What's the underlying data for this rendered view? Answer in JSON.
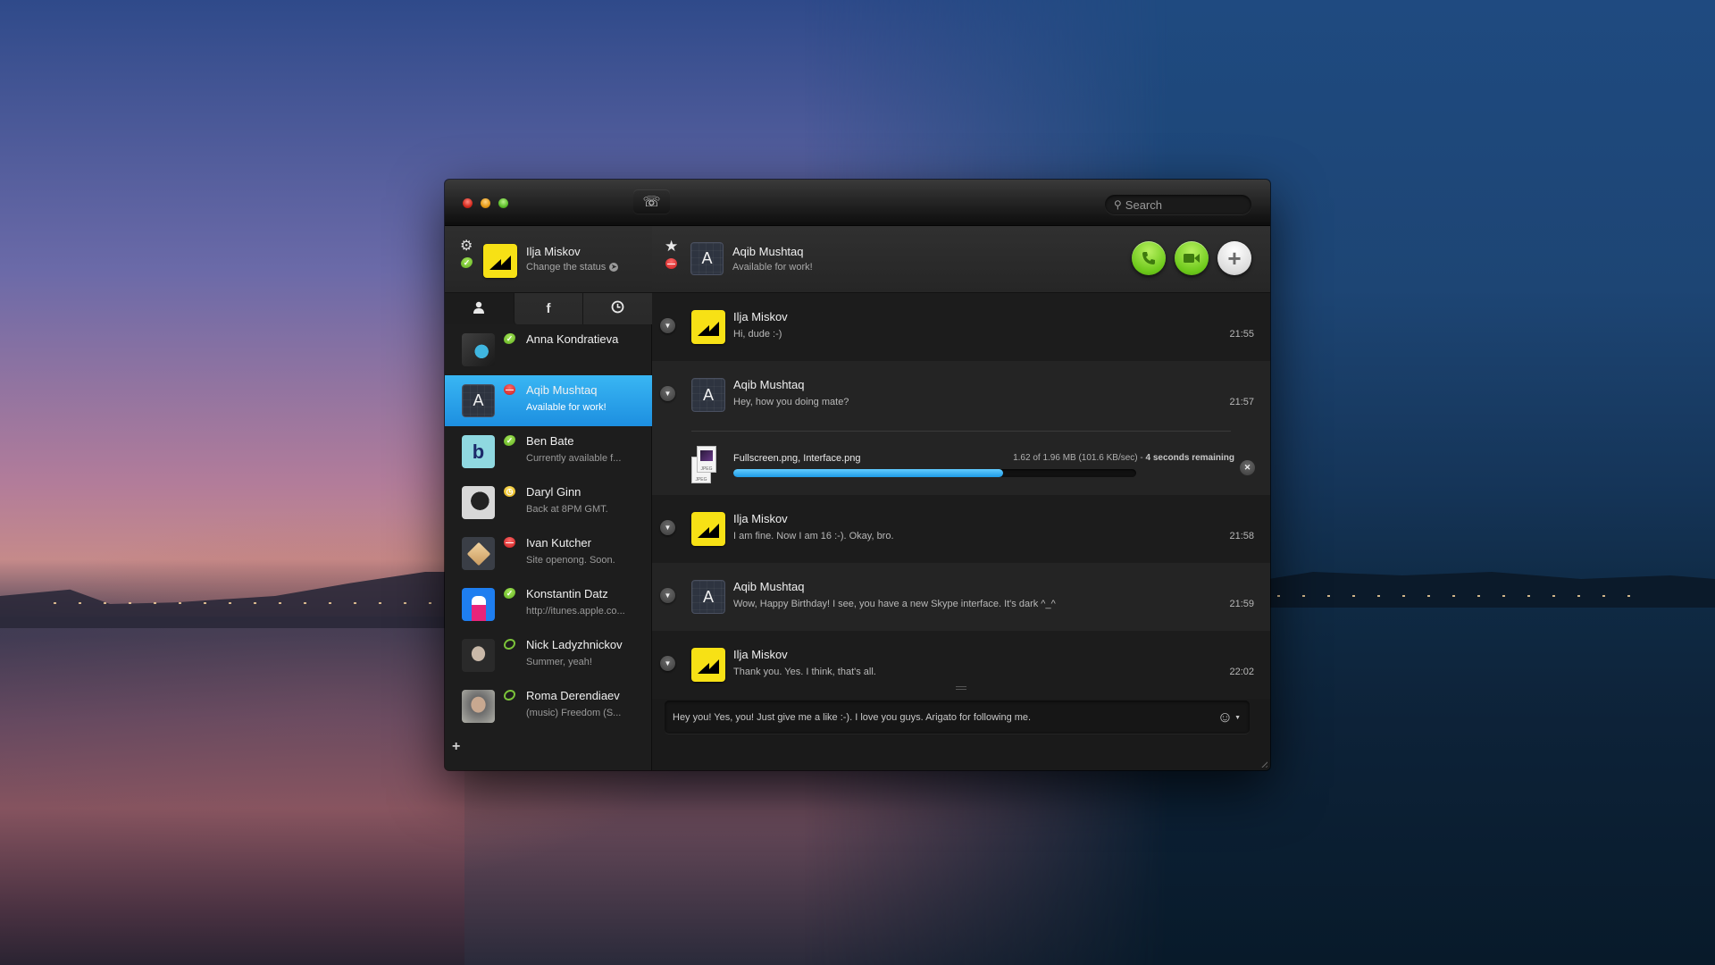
{
  "window": {
    "search_placeholder": "Search"
  },
  "profile": {
    "name": "Ilja Miskov",
    "status_link": "Change the status",
    "status": "online"
  },
  "tabs": [
    {
      "name": "contacts",
      "icon": "person-icon",
      "glyph": "👤",
      "active": true
    },
    {
      "name": "facebook",
      "icon": "facebook-icon",
      "glyph": "f",
      "active": false
    },
    {
      "name": "recent",
      "icon": "clock-icon",
      "glyph": "◷",
      "active": false
    }
  ],
  "contacts": [
    {
      "name": "Anna Kondratieva",
      "mood": "",
      "status": "online",
      "selected": false
    },
    {
      "name": "Aqib Mushtaq",
      "mood": "Available for work!",
      "status": "busy",
      "selected": true
    },
    {
      "name": "Ben Bate",
      "mood": "Currently available f...",
      "status": "online",
      "selected": false
    },
    {
      "name": "Daryl Ginn",
      "mood": "Back at 8PM GMT.",
      "status": "away",
      "selected": false
    },
    {
      "name": "Ivan Kutcher",
      "mood": "Site openong. Soon.",
      "status": "busy",
      "selected": false
    },
    {
      "name": "Konstantin Datz",
      "mood": "http://itunes.apple.co...",
      "status": "online",
      "selected": false
    },
    {
      "name": "Nick Ladyzhnickov",
      "mood": "Summer, yeah!",
      "status": "offline",
      "selected": false
    },
    {
      "name": "Roma Derendiaev",
      "mood": "(music) Freedom (S...",
      "status": "offline",
      "selected": false
    }
  ],
  "chat_header": {
    "name": "Aqib Mushtaq",
    "mood": "Available for work!",
    "avatar_letter": "A",
    "status": "busy"
  },
  "messages": [
    {
      "sender": "Ilja Miskov",
      "text": "Hi, dude :-)",
      "time": "21:55"
    },
    {
      "sender": "Aqib Mushtaq",
      "text": "Hey, how you doing mate?",
      "time": "21:57"
    },
    {
      "sender": "Ilja Miskov",
      "text": "I am fine. Now I am 16 :-). Okay, bro.",
      "time": "21:58"
    },
    {
      "sender": "Aqib Mushtaq",
      "text": "Wow, Happy Birthday! I see, you have a new Skype interface. It's dark ^_^",
      "time": "21:59"
    },
    {
      "sender": "Ilja Miskov",
      "text": "Thank you. Yes. I think, that's all.",
      "time": "22:02"
    }
  ],
  "file_transfer": {
    "files": "Fullscreen.png,  Interface.png",
    "progress_text": "1.62 of 1.96 MB (101.6 KB/sec) - ",
    "remaining": "4 seconds remaining",
    "progress": 0.67,
    "file_type_label": "JPEG"
  },
  "composer": {
    "value": "Hey you! Yes, you! Just give me a like :-). I love you guys. Arigato for following me."
  },
  "colors": {
    "accent_selected": "#2aa4ee",
    "progress": "#34b0f3",
    "call_green": "#7ed321",
    "avatar_yellow": "#f7e115"
  }
}
